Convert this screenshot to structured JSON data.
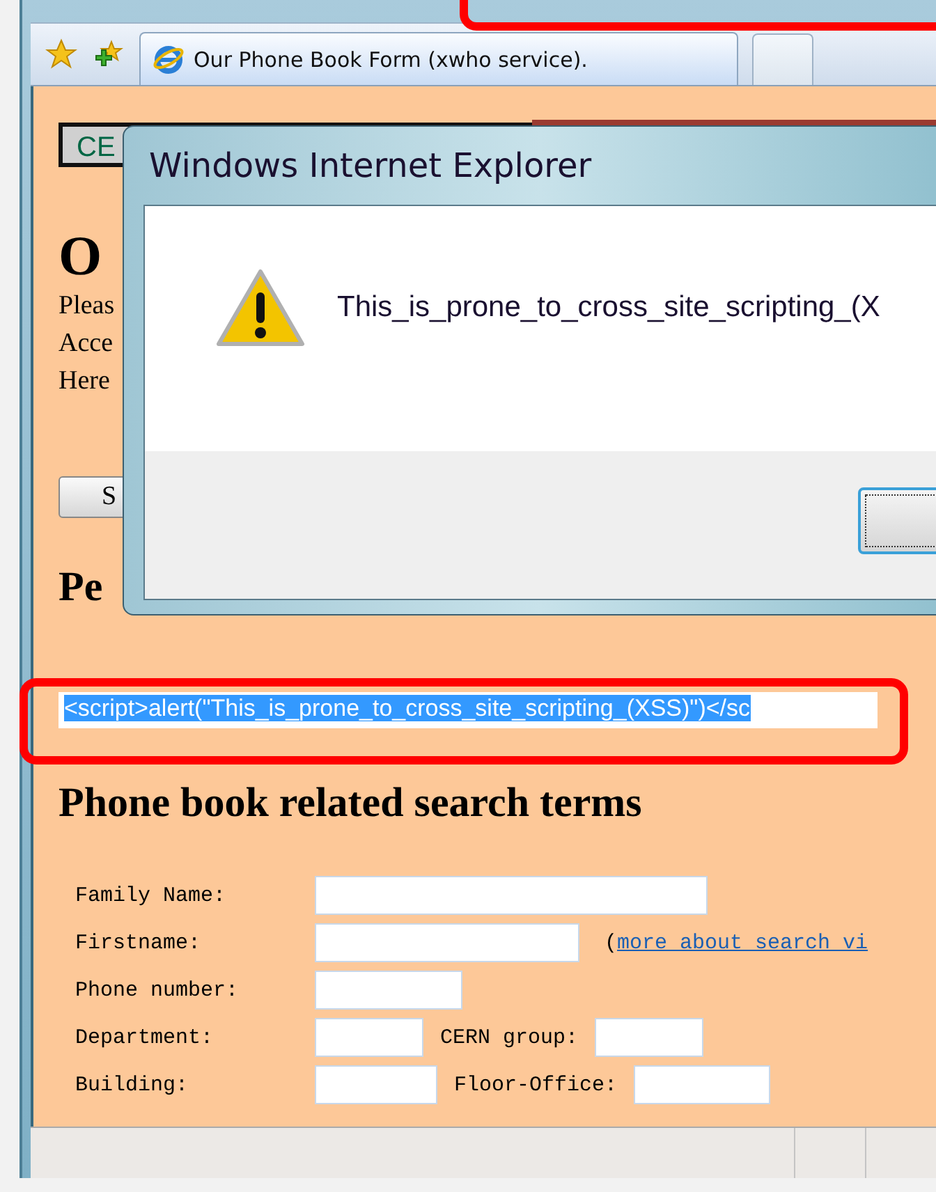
{
  "browser": {
    "tab_title": "Our Phone Book Form (xwho service)."
  },
  "page": {
    "nav_tabs": [
      {
        "label": "CE"
      }
    ],
    "heading": "O",
    "intro_lines": [
      "Pleas",
      "Acce",
      "Here"
    ],
    "button": "S",
    "section_heading": "Pe",
    "injected_field": {
      "value": "<script>alert(\"This_is_prone_to_cross_site_scripting_(XSS)\")</sc",
      "selected": true
    },
    "search_heading": "Phone book related search terms",
    "rows": [
      {
        "fields": [
          {
            "label": "Family Name:"
          }
        ]
      },
      {
        "fields": [
          {
            "label": "Firstname:"
          }
        ],
        "note_prefix": "(",
        "note_link": "more about search vi"
      },
      {
        "fields": [
          {
            "label": "Phone number:"
          }
        ]
      },
      {
        "fields": [
          {
            "label": "Department:"
          },
          {
            "label": "CERN group:"
          }
        ]
      },
      {
        "fields": [
          {
            "label": "Building:"
          },
          {
            "label": "Floor-Office:"
          }
        ]
      }
    ]
  },
  "dialog": {
    "title": "Windows Internet Explorer",
    "message": "This_is_prone_to_cross_site_scripting_(X"
  }
}
